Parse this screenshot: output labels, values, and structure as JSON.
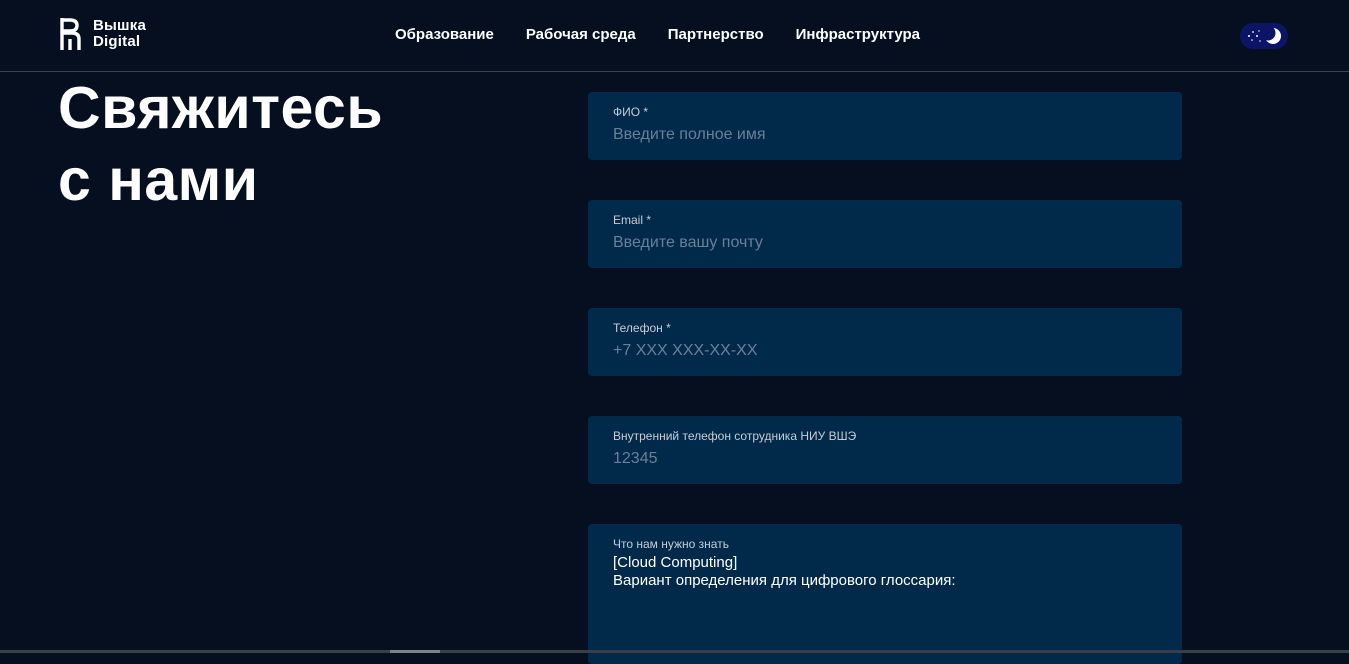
{
  "brand": {
    "line1": "Вышка",
    "line2": "Digital"
  },
  "nav": {
    "items": [
      {
        "label": "Образование"
      },
      {
        "label": "Рабочая среда"
      },
      {
        "label": "Партнерство"
      },
      {
        "label": "Инфраструктура"
      }
    ]
  },
  "theme_toggle": {
    "icon": "moon-icon",
    "mode": "dark"
  },
  "heading": {
    "line1": "Свяжитесь",
    "line2": "с нами"
  },
  "form": {
    "full_name": {
      "label": "ФИО *",
      "placeholder": "Введите полное имя",
      "value": ""
    },
    "email": {
      "label": "Email *",
      "placeholder": "Введите вашу почту",
      "value": ""
    },
    "phone": {
      "label": "Телефон *",
      "placeholder": "+7 XXX XXX-XX-XX",
      "value": ""
    },
    "internal_phone": {
      "label": "Внутренний телефон сотрудника НИУ ВШЭ",
      "placeholder": "12345",
      "value": ""
    },
    "message": {
      "label": "Что нам нужно знать",
      "value": "[Cloud Computing]\nВариант определения для цифрового глоссария:"
    }
  },
  "colors": {
    "background": "#050f20",
    "field_background": "#012a4a",
    "toggle_background": "#0c1466",
    "placeholder": "#6b7f96"
  }
}
